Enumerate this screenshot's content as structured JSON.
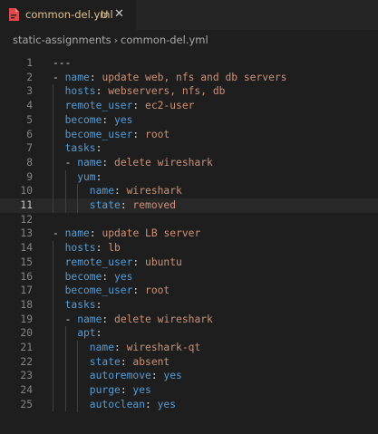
{
  "tab": {
    "filename": "common-del.yml",
    "modified_marker": "U",
    "close_glyph": "✕",
    "icon": "yaml-file-icon"
  },
  "breadcrumb": {
    "folder": "static-assignments",
    "separator": "›",
    "file": "common-del.yml"
  },
  "editor": {
    "current_line": 11,
    "lines": [
      {
        "n": "1",
        "indent": 0,
        "parts": [
          {
            "t": "---",
            "c": "p"
          }
        ]
      },
      {
        "n": "2",
        "indent": 0,
        "parts": [
          {
            "t": "- ",
            "c": "p"
          },
          {
            "t": "name",
            "c": "k"
          },
          {
            "t": ": ",
            "c": "p"
          },
          {
            "t": "update web, nfs and db servers",
            "c": "v"
          }
        ]
      },
      {
        "n": "3",
        "indent": 1,
        "parts": [
          {
            "t": "hosts",
            "c": "k"
          },
          {
            "t": ": ",
            "c": "p"
          },
          {
            "t": "webservers, nfs, db",
            "c": "v"
          }
        ]
      },
      {
        "n": "4",
        "indent": 1,
        "parts": [
          {
            "t": "remote_user",
            "c": "k"
          },
          {
            "t": ": ",
            "c": "p"
          },
          {
            "t": "ec2-user",
            "c": "v"
          }
        ]
      },
      {
        "n": "5",
        "indent": 1,
        "parts": [
          {
            "t": "become",
            "c": "k"
          },
          {
            "t": ": ",
            "c": "p"
          },
          {
            "t": "yes",
            "c": "k"
          }
        ]
      },
      {
        "n": "6",
        "indent": 1,
        "parts": [
          {
            "t": "become_user",
            "c": "k"
          },
          {
            "t": ": ",
            "c": "p"
          },
          {
            "t": "root",
            "c": "v"
          }
        ]
      },
      {
        "n": "7",
        "indent": 1,
        "parts": [
          {
            "t": "tasks",
            "c": "k"
          },
          {
            "t": ":",
            "c": "p"
          }
        ]
      },
      {
        "n": "8",
        "indent": 1,
        "parts": [
          {
            "t": "- ",
            "c": "p"
          },
          {
            "t": "name",
            "c": "k"
          },
          {
            "t": ": ",
            "c": "p"
          },
          {
            "t": "delete wireshark",
            "c": "v"
          }
        ]
      },
      {
        "n": "9",
        "indent": 2,
        "parts": [
          {
            "t": "yum",
            "c": "k"
          },
          {
            "t": ":",
            "c": "p"
          }
        ]
      },
      {
        "n": "10",
        "indent": 3,
        "parts": [
          {
            "t": "name",
            "c": "k"
          },
          {
            "t": ": ",
            "c": "p"
          },
          {
            "t": "wireshark",
            "c": "v"
          }
        ]
      },
      {
        "n": "11",
        "indent": 3,
        "parts": [
          {
            "t": "state",
            "c": "k"
          },
          {
            "t": ": ",
            "c": "p"
          },
          {
            "t": "removed",
            "c": "v"
          }
        ]
      },
      {
        "n": "12",
        "indent": 0,
        "parts": []
      },
      {
        "n": "13",
        "indent": 0,
        "parts": [
          {
            "t": "- ",
            "c": "p"
          },
          {
            "t": "name",
            "c": "k"
          },
          {
            "t": ": ",
            "c": "p"
          },
          {
            "t": "update LB server",
            "c": "v"
          }
        ]
      },
      {
        "n": "14",
        "indent": 1,
        "parts": [
          {
            "t": "hosts",
            "c": "k"
          },
          {
            "t": ": ",
            "c": "p"
          },
          {
            "t": "lb",
            "c": "v"
          }
        ]
      },
      {
        "n": "15",
        "indent": 1,
        "parts": [
          {
            "t": "remote_user",
            "c": "k"
          },
          {
            "t": ": ",
            "c": "p"
          },
          {
            "t": "ubuntu",
            "c": "v"
          }
        ]
      },
      {
        "n": "16",
        "indent": 1,
        "parts": [
          {
            "t": "become",
            "c": "k"
          },
          {
            "t": ": ",
            "c": "p"
          },
          {
            "t": "yes",
            "c": "k"
          }
        ]
      },
      {
        "n": "17",
        "indent": 1,
        "parts": [
          {
            "t": "become_user",
            "c": "k"
          },
          {
            "t": ": ",
            "c": "p"
          },
          {
            "t": "root",
            "c": "v"
          }
        ]
      },
      {
        "n": "18",
        "indent": 1,
        "parts": [
          {
            "t": "tasks",
            "c": "k"
          },
          {
            "t": ":",
            "c": "p"
          }
        ]
      },
      {
        "n": "19",
        "indent": 1,
        "parts": [
          {
            "t": "- ",
            "c": "p"
          },
          {
            "t": "name",
            "c": "k"
          },
          {
            "t": ": ",
            "c": "p"
          },
          {
            "t": "delete wireshark",
            "c": "v"
          }
        ]
      },
      {
        "n": "20",
        "indent": 2,
        "parts": [
          {
            "t": "apt",
            "c": "k"
          },
          {
            "t": ":",
            "c": "p"
          }
        ]
      },
      {
        "n": "21",
        "indent": 3,
        "parts": [
          {
            "t": "name",
            "c": "k"
          },
          {
            "t": ": ",
            "c": "p"
          },
          {
            "t": "wireshark-qt",
            "c": "v"
          }
        ]
      },
      {
        "n": "22",
        "indent": 3,
        "parts": [
          {
            "t": "state",
            "c": "k"
          },
          {
            "t": ": ",
            "c": "p"
          },
          {
            "t": "absent",
            "c": "v"
          }
        ]
      },
      {
        "n": "23",
        "indent": 3,
        "parts": [
          {
            "t": "autoremove",
            "c": "k"
          },
          {
            "t": ": ",
            "c": "p"
          },
          {
            "t": "yes",
            "c": "k"
          }
        ]
      },
      {
        "n": "24",
        "indent": 3,
        "parts": [
          {
            "t": "purge",
            "c": "k"
          },
          {
            "t": ": ",
            "c": "p"
          },
          {
            "t": "yes",
            "c": "k"
          }
        ]
      },
      {
        "n": "25",
        "indent": 3,
        "parts": [
          {
            "t": "autoclean",
            "c": "k"
          },
          {
            "t": ": ",
            "c": "p"
          },
          {
            "t": "yes",
            "c": "k"
          }
        ]
      }
    ]
  },
  "colors": {
    "background": "#1e1e1e",
    "key": "#569cd6",
    "string": "#ce9178",
    "modified": "#e2c08d",
    "yaml_icon": "#e04a4a"
  }
}
